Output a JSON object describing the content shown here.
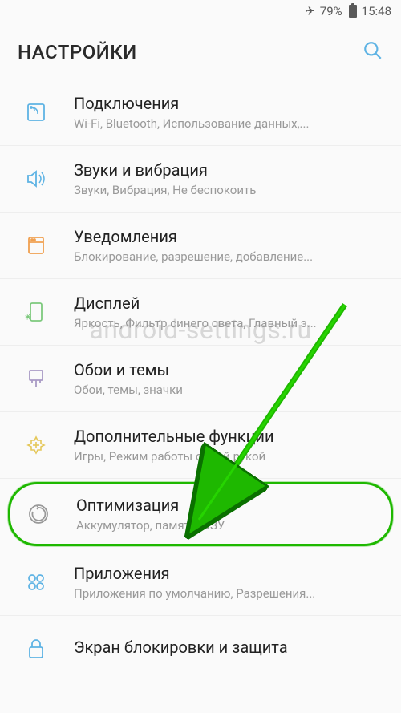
{
  "status_bar": {
    "battery_percent": "79%",
    "time": "15:48"
  },
  "header": {
    "title": "НАСТРОЙКИ"
  },
  "items": [
    {
      "title": "Подключения",
      "subtitle": "Wi-Fi, Bluetooth, Использование данных,..."
    },
    {
      "title": "Звуки и вибрация",
      "subtitle": "Звуки, Вибрация, Не беспокоить"
    },
    {
      "title": "Уведомления",
      "subtitle": "Блокирование, разрешение, добавление..."
    },
    {
      "title": "Дисплей",
      "subtitle": "Яркость, Фильтр синего света, Главный э..."
    },
    {
      "title": "Обои и темы",
      "subtitle": "Обои, темы, значки"
    },
    {
      "title": "Дополнительные функции",
      "subtitle": "Игры, Режим работы одной рукой"
    },
    {
      "title": "Оптимизация",
      "subtitle": "Аккумулятор, память, ОЗУ"
    },
    {
      "title": "Приложения",
      "subtitle": "Приложения по умолчанию, Разрешения..."
    },
    {
      "title": "Экран блокировки и защита",
      "subtitle": ""
    }
  ],
  "watermark": "android-settings.ru",
  "colors": {
    "icon_blue": "#5eb3e4",
    "icon_orange": "#f0a050",
    "icon_green": "#7dc97d",
    "icon_purple": "#a99ac5",
    "icon_yellow": "#e5c85a",
    "highlight": "#1eb800"
  }
}
